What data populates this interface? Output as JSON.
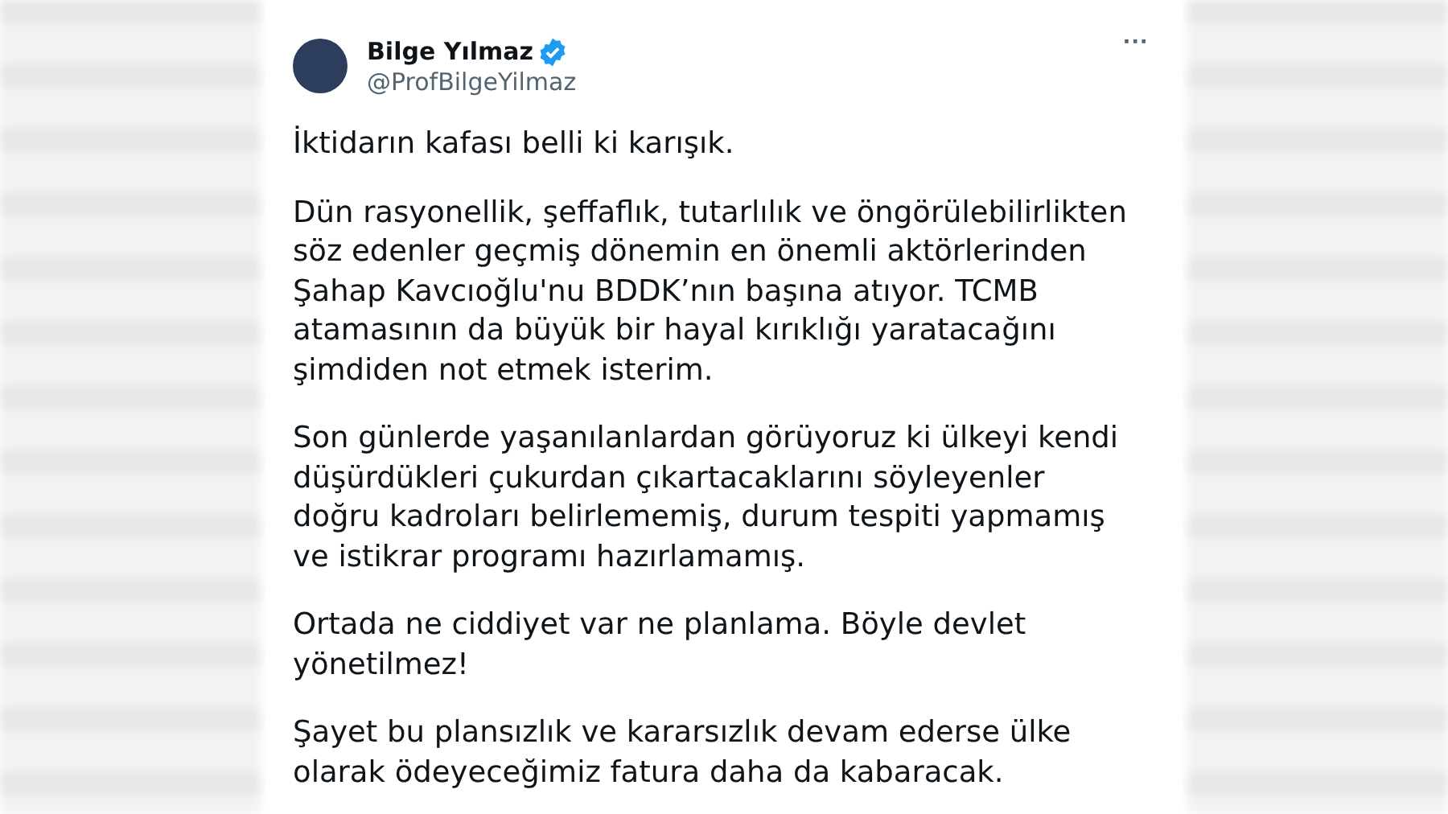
{
  "tweet": {
    "author": {
      "name": "Bilge Yılmaz",
      "verified": true,
      "handle": "@ProfBilgeYilmaz"
    },
    "more": "···",
    "paragraphs": [
      "İktidarın kafası belli ki karışık.",
      "Dün rasyonellik, şeffaflık, tutarlılık ve öngörülebilirlikten\nsöz edenler geçmiş dönemin en önemli aktörlerinden\nŞahap Kavcıoğlu'nu BDDK’nın başına atıyor. TCMB\natamasının da büyük bir hayal kırıklığı yaratacağını\nşimdiden not etmek isterim.",
      "Son günlerde yaşanılanlardan görüyoruz ki ülkeyi kendi\ndüşürdükleri çukurdan çıkartacaklarını söyleyenler\ndoğru kadroları belirlememiş, durum tespiti yapmamış\nve istikrar programı hazırlamamış.",
      "Ortada ne ciddiyet var ne planlama. Böyle devlet\nyönetilmez!",
      "Şayet bu plansızlık ve kararsızlık devam ederse ülke\nolarak ödeyeceğimiz fatura daha da kabaracak."
    ]
  }
}
